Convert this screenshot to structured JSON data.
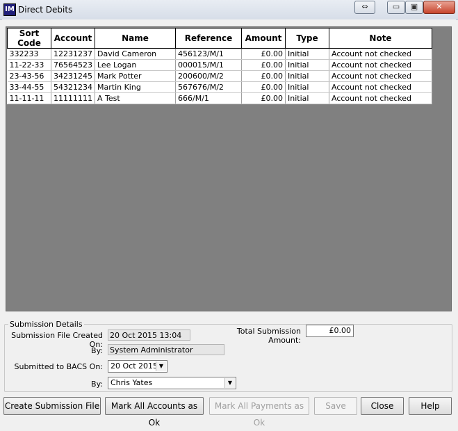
{
  "window": {
    "title": "Direct Debits",
    "icon_text": "IM",
    "controls": {
      "restore_glyph": "⇔",
      "min_glyph": "▭",
      "max_glyph": "▣",
      "close_glyph": "✕"
    }
  },
  "grid": {
    "columns": [
      "Sort Code",
      "Account",
      "Name",
      "Reference",
      "Amount",
      "Type",
      "Note"
    ],
    "rows": [
      [
        "332233",
        "12231237",
        "David Cameron",
        "456123/M/1",
        "£0.00",
        "Initial",
        "Account not checked"
      ],
      [
        "11-22-33",
        "76564523",
        "Lee Logan",
        "000015/M/1",
        "£0.00",
        "Initial",
        "Account not checked"
      ],
      [
        "23-43-56",
        "34231245",
        "Mark Potter",
        "200600/M/2",
        "£0.00",
        "Initial",
        "Account not checked"
      ],
      [
        "33-44-55",
        "54321234",
        "Martin King",
        "567676/M/2",
        "£0.00",
        "Initial",
        "Account not checked"
      ],
      [
        "11-11-11",
        "11111111",
        "A Test",
        "666/M/1",
        "£0.00",
        "Initial",
        "Account not checked"
      ]
    ]
  },
  "details": {
    "legend": "Submission Details",
    "created_label": "Submission File Created On:",
    "created_value": "20 Oct 2015 13:04",
    "by_label": "By:",
    "by_value": "System Administrator",
    "submitted_label": "Submitted to BACS On:",
    "submitted_value": "20 Oct  2015",
    "submitted_by_label": "By:",
    "submitted_by_value": "Chris Yates",
    "total_label": "Total Submission Amount:",
    "total_value": "£0.00"
  },
  "buttons": {
    "create": "Create Submission File",
    "mark_accounts": "Mark All Accounts as Ok",
    "mark_payments": "Mark All Payments as Ok",
    "save": "Save",
    "close": "Close",
    "help": "Help"
  }
}
